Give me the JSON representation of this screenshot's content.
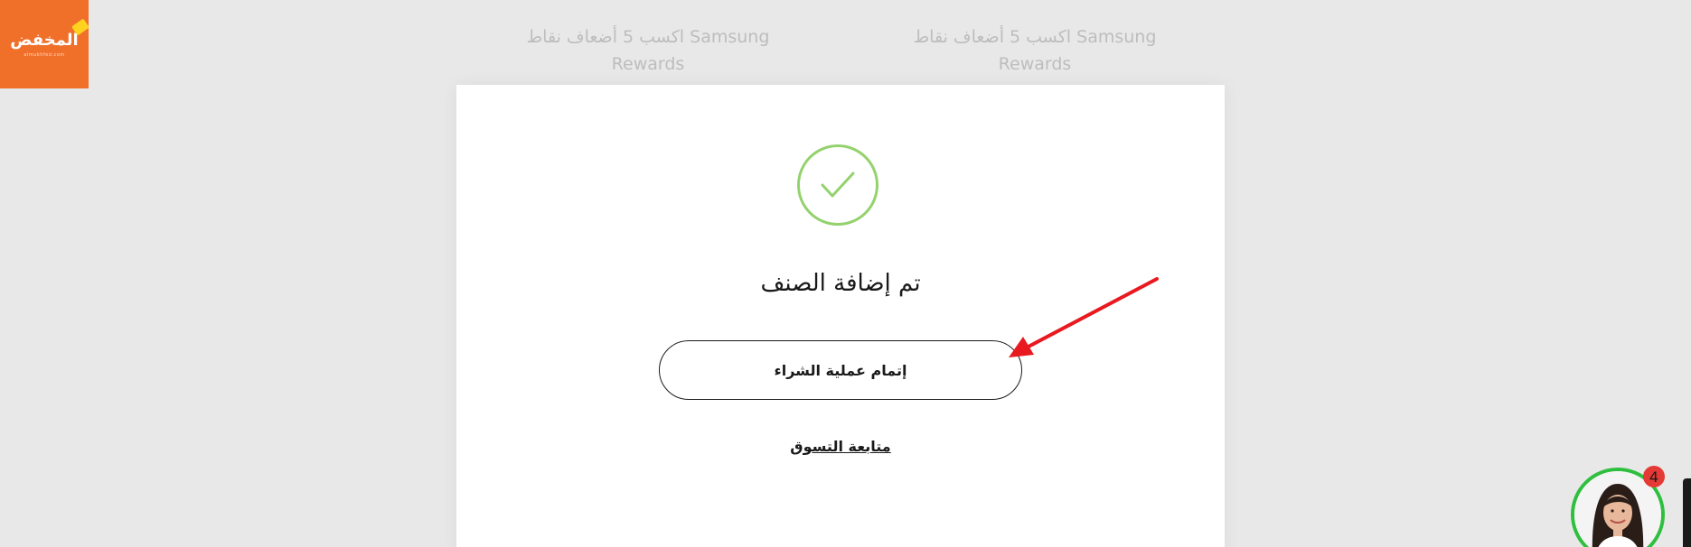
{
  "brand": {
    "logo_text": "المخفض",
    "logo_subtext": "almukhfed.com",
    "logo_color": "#f0702a"
  },
  "background_promos": [
    {
      "line1": "اكسب 5 أضعاف نقاط Samsung",
      "line2": "Rewards"
    },
    {
      "line1": "اكسب 5 أضعاف نقاط Samsung",
      "line2": "Rewards"
    }
  ],
  "modal": {
    "icon": "checkmark-icon",
    "title": "تم إضافة الصنف",
    "checkout_label": "إتمام عملية الشراء",
    "continue_label": "متابعة التسوق",
    "accent_color": "#94d26d"
  },
  "annotation": {
    "arrow_color": "#e8191f"
  },
  "chat": {
    "badge_count": "4",
    "border_color": "#2fbf3f"
  }
}
